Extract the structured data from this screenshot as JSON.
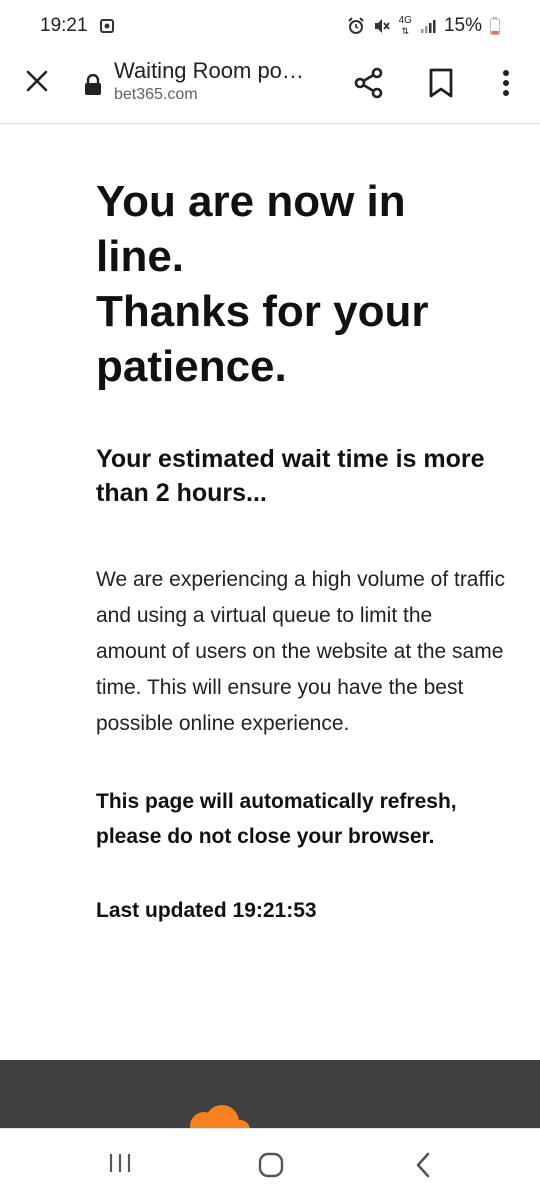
{
  "status_bar": {
    "time": "19:21",
    "network": "4G",
    "battery": "15%"
  },
  "toolbar": {
    "title": "Waiting Room po…",
    "url": "bet365.com"
  },
  "page": {
    "heading_lines": [
      "You are now in",
      "line.",
      "Thanks for your",
      "patience."
    ],
    "wait_time": "Your estimated wait time is more than 2 hours...",
    "description": "We are experiencing a high volume of traffic and using a virtual queue to limit the amount of users on the website at the same time. This will ensure you have the best possible online experience.",
    "refresh_notice": "This page will automatically refresh, please do not close your browser.",
    "last_updated": "Last updated 19:21:53"
  },
  "colors": {
    "footer_bg": "#404040",
    "cloud_orange": "#f6821f",
    "battery_low": "#e66a5a"
  },
  "icons": {
    "close": "close-icon",
    "lock": "lock-icon",
    "share": "share-icon",
    "bookmark": "bookmark-icon",
    "menu": "more-vert-icon"
  }
}
